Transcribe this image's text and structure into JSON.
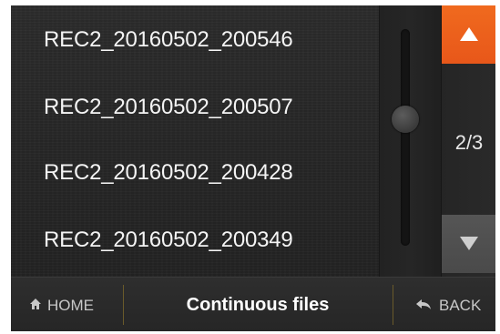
{
  "files": [
    {
      "name": "REC2_20160502_200546"
    },
    {
      "name": "REC2_20160502_200507"
    },
    {
      "name": "REC2_20160502_200428"
    },
    {
      "name": "REC2_20160502_200349"
    }
  ],
  "pager": {
    "indicator": "2/3",
    "current_page": 2,
    "total_pages": 3
  },
  "nav": {
    "home_label": "HOME",
    "title": "Continuous files",
    "back_label": "BACK"
  },
  "icons": {
    "up": "triangle-up-icon",
    "down": "triangle-down-icon",
    "home": "home-icon",
    "back": "back-arrow-icon"
  },
  "colors": {
    "accent": "#e8571a",
    "background": "#262626",
    "text": "#f4f4f4"
  }
}
